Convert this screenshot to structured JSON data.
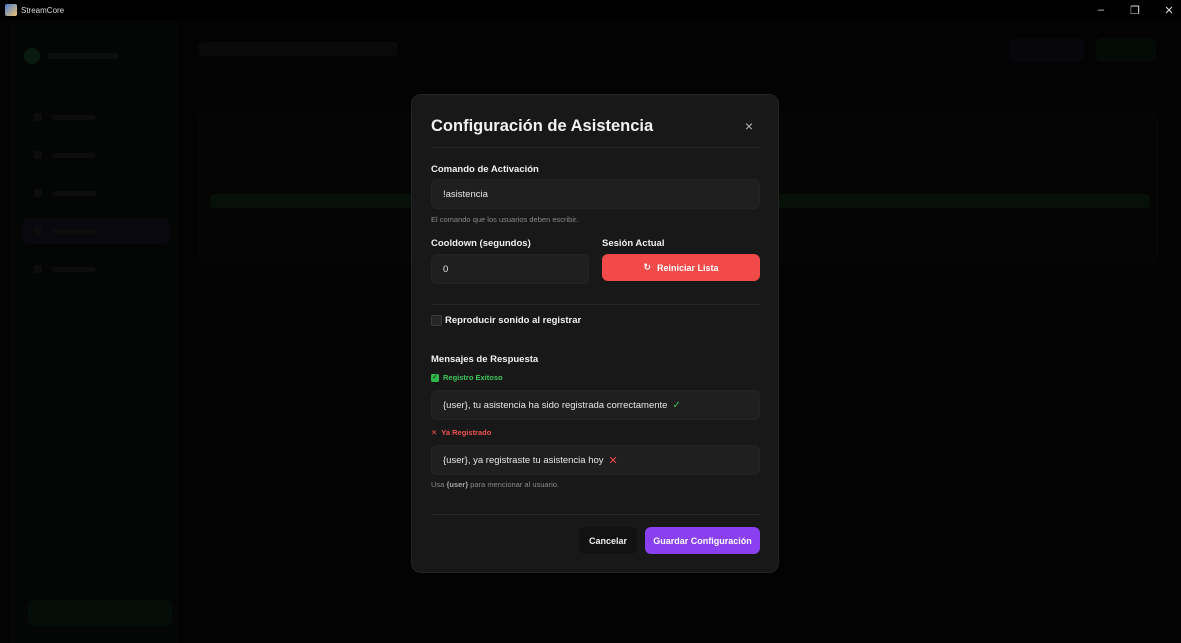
{
  "window": {
    "title": "StreamCore",
    "minimize_glyph": "–",
    "maximize_glyph": "❐",
    "close_glyph": "✕"
  },
  "modal": {
    "title": "Configuración de Asistencia",
    "close_glyph": "×",
    "command": {
      "label": "Comando de Activación",
      "value": "!asistencia",
      "help": "El comando que los usuarios deben escribir."
    },
    "cooldown": {
      "label": "Cooldown (segundos)",
      "value": "0"
    },
    "session": {
      "label": "Sesión Actual",
      "reset_icon": "↻",
      "reset_button": "Reiniciar Lista"
    },
    "sound_checkbox": {
      "label": "Reproducir sonido al registrar",
      "checked": false
    },
    "responses": {
      "title": "Mensajes de Respuesta",
      "success": {
        "tag_icon": "✓",
        "tag": "Registro Exitoso",
        "message": "{user}, tu asistencia ha sido registrada correctamente",
        "message_icon": "✓"
      },
      "already": {
        "tag_icon": "✕",
        "tag": "Ya Registrado",
        "message": "{user}, ya registraste tu asistencia hoy",
        "message_icon": "✕"
      },
      "help_prefix": "Usa",
      "help_token": "{user}",
      "help_suffix": "para mencionar al usuario."
    },
    "cancel_button": "Cancelar",
    "save_button": "Guardar Configuración"
  },
  "colors": {
    "accent_purple": "#8a3ff0",
    "danger_red": "#f24949",
    "success_green": "#3ec65a",
    "modal_bg": "#181818"
  }
}
